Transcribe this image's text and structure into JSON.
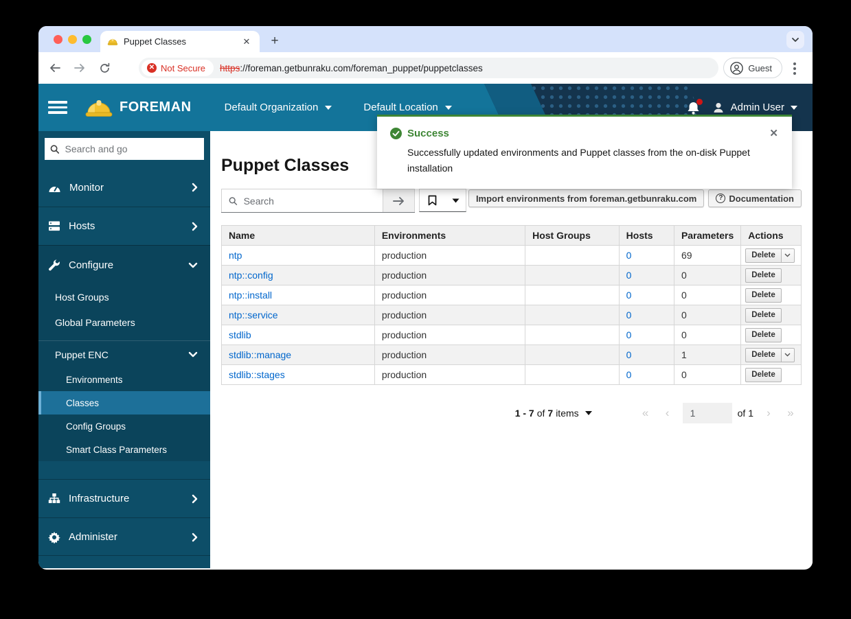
{
  "browser": {
    "tab_title": "Puppet Classes",
    "close_glyph": "✕",
    "new_tab_glyph": "+",
    "security_badge": "Not Secure",
    "security_icon_glyph": "✕",
    "url_scheme": "https",
    "url_rest": "://foreman.getbunraku.com/foreman_puppet/puppetclasses",
    "profile_label": "Guest"
  },
  "masthead": {
    "brand": "FOREMAN",
    "org_menu": "Default Organization",
    "loc_menu": "Default Location",
    "user_menu": "Admin User"
  },
  "toast": {
    "title": "Success",
    "message": "Successfully updated environments and Puppet classes from the on-disk Puppet installation",
    "close_glyph": "✕"
  },
  "sidebar": {
    "search_placeholder": "Search and go",
    "monitor": "Monitor",
    "hosts": "Hosts",
    "configure": "Configure",
    "infrastructure": "Infrastructure",
    "administer": "Administer",
    "configure_children": {
      "host_groups": "Host Groups",
      "global_parameters": "Global Parameters",
      "puppet_enc": "Puppet ENC"
    },
    "puppet_enc_children": {
      "environments": "Environments",
      "classes": "Classes",
      "config_groups": "Config Groups",
      "smart_class_parameters": "Smart Class Parameters"
    }
  },
  "main": {
    "title": "Puppet Classes",
    "search_placeholder": "Search",
    "import_button": "Import environments from foreman.getbunraku.com",
    "documentation_button": "Documentation",
    "documentation_icon_glyph": "?",
    "table": {
      "columns": [
        "Name",
        "Environments",
        "Host Groups",
        "Hosts",
        "Parameters",
        "Actions"
      ],
      "delete_label": "Delete",
      "rows": [
        {
          "name": "ntp",
          "environments": "production",
          "host_groups": "",
          "hosts": "0",
          "parameters": "69"
        },
        {
          "name": "ntp::config",
          "environments": "production",
          "host_groups": "",
          "hosts": "0",
          "parameters": "0"
        },
        {
          "name": "ntp::install",
          "environments": "production",
          "host_groups": "",
          "hosts": "0",
          "parameters": "0"
        },
        {
          "name": "ntp::service",
          "environments": "production",
          "host_groups": "",
          "hosts": "0",
          "parameters": "0"
        },
        {
          "name": "stdlib",
          "environments": "production",
          "host_groups": "",
          "hosts": "0",
          "parameters": "0"
        },
        {
          "name": "stdlib::manage",
          "environments": "production",
          "host_groups": "",
          "hosts": "0",
          "parameters": "1"
        },
        {
          "name": "stdlib::stages",
          "environments": "production",
          "host_groups": "",
          "hosts": "0",
          "parameters": "0"
        }
      ]
    },
    "pagination": {
      "range": "1 - 7",
      "of_word": "of",
      "total": "7",
      "items_word": "items",
      "first_glyph": "«",
      "prev_glyph": "‹",
      "next_glyph": "›",
      "last_glyph": "»",
      "current_page": "1",
      "of_pages": "of 1"
    }
  },
  "colors": {
    "masthead_teal": "#13749a",
    "masthead_navy": "#14344d",
    "sidebar": "#0d4e68",
    "success_green": "#3e8635",
    "link_blue": "#0066cc",
    "notsecure_red": "#d93025"
  }
}
